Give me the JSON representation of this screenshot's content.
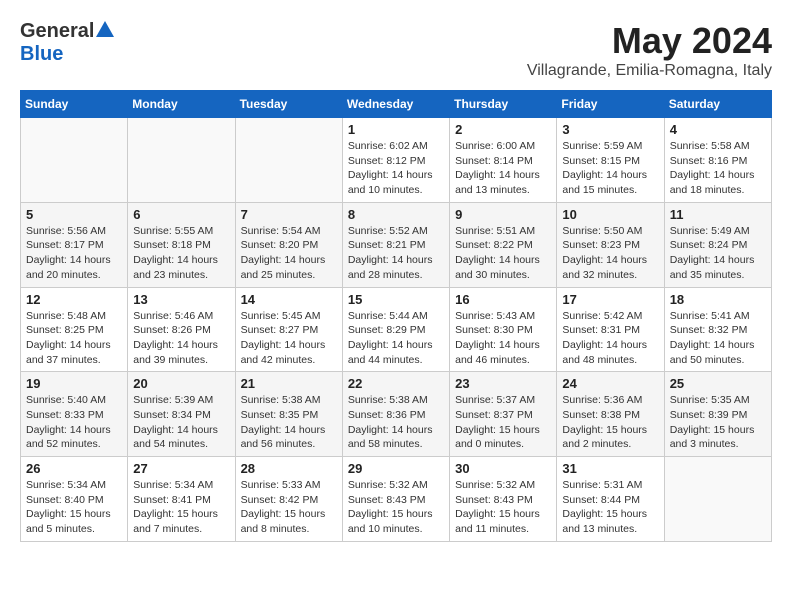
{
  "logo": {
    "general": "General",
    "blue": "Blue"
  },
  "header": {
    "month": "May 2024",
    "location": "Villagrande, Emilia-Romagna, Italy"
  },
  "days_of_week": [
    "Sunday",
    "Monday",
    "Tuesday",
    "Wednesday",
    "Thursday",
    "Friday",
    "Saturday"
  ],
  "weeks": [
    [
      {
        "day": "",
        "info": ""
      },
      {
        "day": "",
        "info": ""
      },
      {
        "day": "",
        "info": ""
      },
      {
        "day": "1",
        "info": "Sunrise: 6:02 AM\nSunset: 8:12 PM\nDaylight: 14 hours\nand 10 minutes."
      },
      {
        "day": "2",
        "info": "Sunrise: 6:00 AM\nSunset: 8:14 PM\nDaylight: 14 hours\nand 13 minutes."
      },
      {
        "day": "3",
        "info": "Sunrise: 5:59 AM\nSunset: 8:15 PM\nDaylight: 14 hours\nand 15 minutes."
      },
      {
        "day": "4",
        "info": "Sunrise: 5:58 AM\nSunset: 8:16 PM\nDaylight: 14 hours\nand 18 minutes."
      }
    ],
    [
      {
        "day": "5",
        "info": "Sunrise: 5:56 AM\nSunset: 8:17 PM\nDaylight: 14 hours\nand 20 minutes."
      },
      {
        "day": "6",
        "info": "Sunrise: 5:55 AM\nSunset: 8:18 PM\nDaylight: 14 hours\nand 23 minutes."
      },
      {
        "day": "7",
        "info": "Sunrise: 5:54 AM\nSunset: 8:20 PM\nDaylight: 14 hours\nand 25 minutes."
      },
      {
        "day": "8",
        "info": "Sunrise: 5:52 AM\nSunset: 8:21 PM\nDaylight: 14 hours\nand 28 minutes."
      },
      {
        "day": "9",
        "info": "Sunrise: 5:51 AM\nSunset: 8:22 PM\nDaylight: 14 hours\nand 30 minutes."
      },
      {
        "day": "10",
        "info": "Sunrise: 5:50 AM\nSunset: 8:23 PM\nDaylight: 14 hours\nand 32 minutes."
      },
      {
        "day": "11",
        "info": "Sunrise: 5:49 AM\nSunset: 8:24 PM\nDaylight: 14 hours\nand 35 minutes."
      }
    ],
    [
      {
        "day": "12",
        "info": "Sunrise: 5:48 AM\nSunset: 8:25 PM\nDaylight: 14 hours\nand 37 minutes."
      },
      {
        "day": "13",
        "info": "Sunrise: 5:46 AM\nSunset: 8:26 PM\nDaylight: 14 hours\nand 39 minutes."
      },
      {
        "day": "14",
        "info": "Sunrise: 5:45 AM\nSunset: 8:27 PM\nDaylight: 14 hours\nand 42 minutes."
      },
      {
        "day": "15",
        "info": "Sunrise: 5:44 AM\nSunset: 8:29 PM\nDaylight: 14 hours\nand 44 minutes."
      },
      {
        "day": "16",
        "info": "Sunrise: 5:43 AM\nSunset: 8:30 PM\nDaylight: 14 hours\nand 46 minutes."
      },
      {
        "day": "17",
        "info": "Sunrise: 5:42 AM\nSunset: 8:31 PM\nDaylight: 14 hours\nand 48 minutes."
      },
      {
        "day": "18",
        "info": "Sunrise: 5:41 AM\nSunset: 8:32 PM\nDaylight: 14 hours\nand 50 minutes."
      }
    ],
    [
      {
        "day": "19",
        "info": "Sunrise: 5:40 AM\nSunset: 8:33 PM\nDaylight: 14 hours\nand 52 minutes."
      },
      {
        "day": "20",
        "info": "Sunrise: 5:39 AM\nSunset: 8:34 PM\nDaylight: 14 hours\nand 54 minutes."
      },
      {
        "day": "21",
        "info": "Sunrise: 5:38 AM\nSunset: 8:35 PM\nDaylight: 14 hours\nand 56 minutes."
      },
      {
        "day": "22",
        "info": "Sunrise: 5:38 AM\nSunset: 8:36 PM\nDaylight: 14 hours\nand 58 minutes."
      },
      {
        "day": "23",
        "info": "Sunrise: 5:37 AM\nSunset: 8:37 PM\nDaylight: 15 hours\nand 0 minutes."
      },
      {
        "day": "24",
        "info": "Sunrise: 5:36 AM\nSunset: 8:38 PM\nDaylight: 15 hours\nand 2 minutes."
      },
      {
        "day": "25",
        "info": "Sunrise: 5:35 AM\nSunset: 8:39 PM\nDaylight: 15 hours\nand 3 minutes."
      }
    ],
    [
      {
        "day": "26",
        "info": "Sunrise: 5:34 AM\nSunset: 8:40 PM\nDaylight: 15 hours\nand 5 minutes."
      },
      {
        "day": "27",
        "info": "Sunrise: 5:34 AM\nSunset: 8:41 PM\nDaylight: 15 hours\nand 7 minutes."
      },
      {
        "day": "28",
        "info": "Sunrise: 5:33 AM\nSunset: 8:42 PM\nDaylight: 15 hours\nand 8 minutes."
      },
      {
        "day": "29",
        "info": "Sunrise: 5:32 AM\nSunset: 8:43 PM\nDaylight: 15 hours\nand 10 minutes."
      },
      {
        "day": "30",
        "info": "Sunrise: 5:32 AM\nSunset: 8:43 PM\nDaylight: 15 hours\nand 11 minutes."
      },
      {
        "day": "31",
        "info": "Sunrise: 5:31 AM\nSunset: 8:44 PM\nDaylight: 15 hours\nand 13 minutes."
      },
      {
        "day": "",
        "info": ""
      }
    ]
  ]
}
